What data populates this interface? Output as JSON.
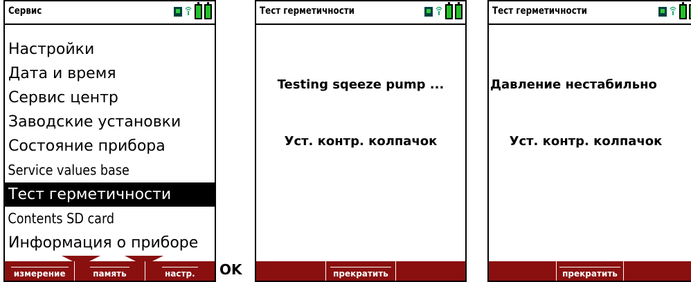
{
  "service_screen": {
    "title": "Сервис",
    "menu": [
      "Настройки",
      "Дата и время",
      "Сервис центр",
      "Заводские установки",
      "Состояние прибора",
      "Service values base",
      "Тест герметичности",
      "Contents SD card",
      "Информация о приборе"
    ],
    "selected_index": 6,
    "softkeys": [
      "измерение",
      "память",
      "настр."
    ]
  },
  "ok_label": "OK",
  "test_screen": {
    "title": "Тест герметичности",
    "message1": "Testing sqeeze pump ...",
    "message2": "Уст. контр. колпачок",
    "softkey": "прекратить"
  },
  "unstable_screen": {
    "title": "Тест герметичности",
    "message1": "Давление нестабильно",
    "message2": "Уст. контр. колпачок",
    "softkey": "прекратить"
  },
  "colors": {
    "softkey_bar": "#8a0f0f",
    "battery": "#22c22a",
    "selected_bg": "#000000"
  }
}
